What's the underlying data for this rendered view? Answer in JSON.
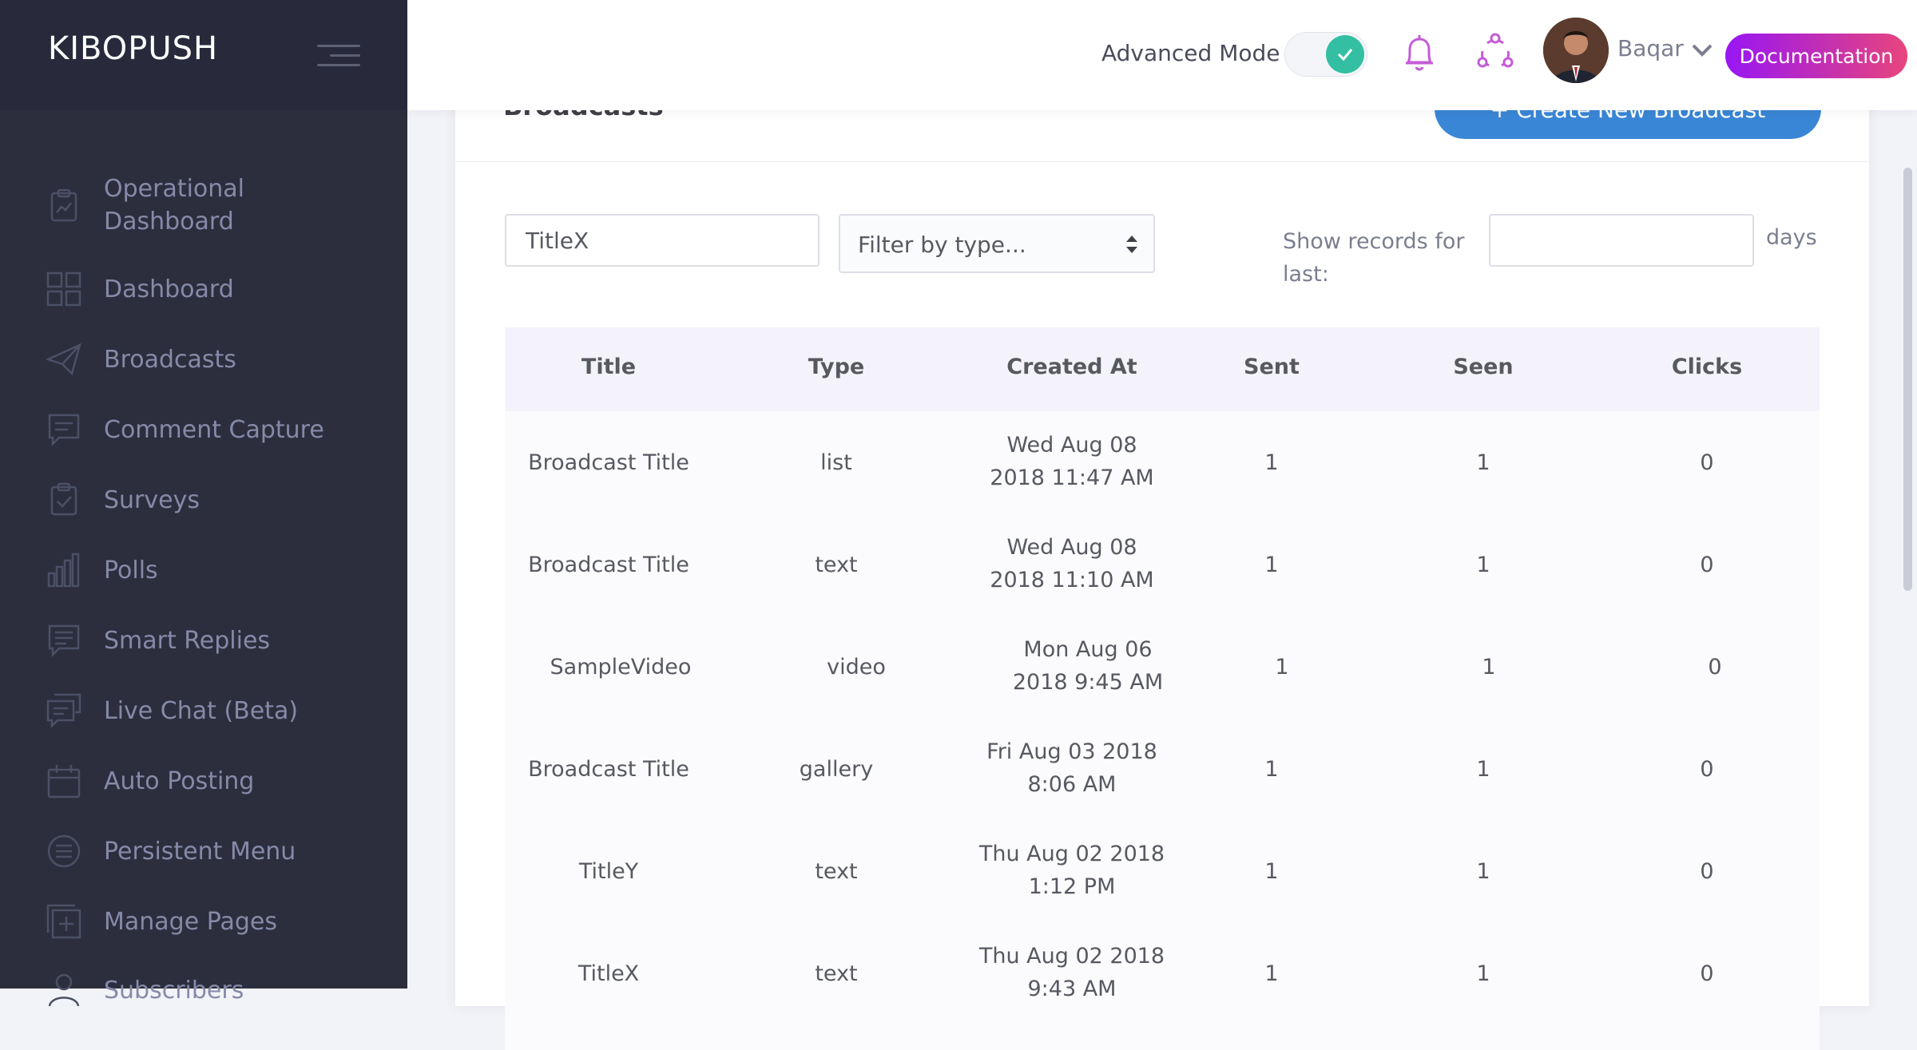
{
  "brand": "KIBOPUSH",
  "sidebar": {
    "items": [
      {
        "label": "Operational Dashboard",
        "icon": "clipboard-chart-icon"
      },
      {
        "label": "Dashboard",
        "icon": "grid-icon"
      },
      {
        "label": "Broadcasts",
        "icon": "paper-plane-icon"
      },
      {
        "label": "Comment Capture",
        "icon": "comment-icon"
      },
      {
        "label": "Surveys",
        "icon": "clipboard-check-icon"
      },
      {
        "label": "Polls",
        "icon": "bar-chart-icon"
      },
      {
        "label": "Smart Replies",
        "icon": "chat-lines-icon"
      },
      {
        "label": "Live Chat (Beta)",
        "icon": "chat-bubbles-icon"
      },
      {
        "label": "Auto Posting",
        "icon": "calendar-icon"
      },
      {
        "label": "Persistent Menu",
        "icon": "menu-circle-icon"
      },
      {
        "label": "Manage Pages",
        "icon": "add-page-icon"
      },
      {
        "label": "Subscribers",
        "icon": "user-icon"
      }
    ]
  },
  "header": {
    "advanced_mode_label": "Advanced Mode",
    "advanced_mode_on": true,
    "username": "Baqar",
    "documentation_label": "Documentation",
    "colors": {
      "toggle": "#34bfa3",
      "doc_start": "#9816f4",
      "doc_end": "#e8457c",
      "icon": "#c45bd6"
    }
  },
  "portlet": {
    "title": "Broadcasts",
    "create_button": "+ Create New Broadcast"
  },
  "filters": {
    "search_value": "TitleX",
    "type_placeholder": "Filter by type...",
    "records_label": "Show records for last:",
    "days_value": "",
    "days_label": "days"
  },
  "table": {
    "headers": [
      "Title",
      "Type",
      "Created At",
      "Sent",
      "Seen",
      "Clicks"
    ],
    "rows": [
      {
        "title": "Broadcast Title",
        "type": "list",
        "created_1": "Wed Aug 08",
        "created_2": "2018 11:47 AM",
        "sent": "1",
        "seen": "1",
        "clicks": "0"
      },
      {
        "title": "Broadcast Title",
        "type": "text",
        "created_1": "Wed Aug 08",
        "created_2": "2018 11:10 AM",
        "sent": "1",
        "seen": "1",
        "clicks": "0"
      },
      {
        "title": "SampleVideo",
        "type": "video",
        "created_1": "Mon Aug 06",
        "created_2": "2018 9:45 AM",
        "sent": "1",
        "seen": "1",
        "clicks": "0"
      },
      {
        "title": "Broadcast Title",
        "type": "gallery",
        "created_1": "Fri Aug 03 2018",
        "created_2": "8:06 AM",
        "sent": "1",
        "seen": "1",
        "clicks": "0"
      },
      {
        "title": "TitleY",
        "type": "text",
        "created_1": "Thu Aug 02 2018",
        "created_2": "1:12 PM",
        "sent": "1",
        "seen": "1",
        "clicks": "0"
      },
      {
        "title": "TitleX",
        "type": "text",
        "created_1": "Thu Aug 02 2018",
        "created_2": "9:43 AM",
        "sent": "1",
        "seen": "1",
        "clicks": "0"
      }
    ]
  }
}
